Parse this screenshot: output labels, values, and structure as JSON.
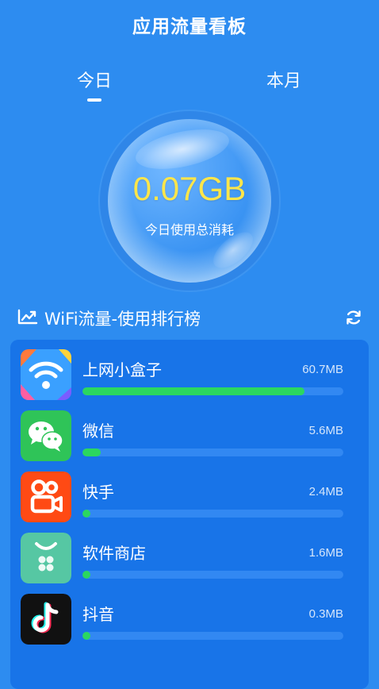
{
  "header": {
    "title": "应用流量看板"
  },
  "tabs": [
    {
      "label": "今日",
      "active": true
    },
    {
      "label": "本月",
      "active": false
    }
  ],
  "summary": {
    "value": "0.07GB",
    "caption": "今日使用总消耗"
  },
  "ranking": {
    "title": "WiFi流量-使用排行榜",
    "icon": "trend-chart-icon",
    "refresh_icon": "refresh-icon"
  },
  "apps": [
    {
      "name": "上网小盒子",
      "usage": "60.7MB",
      "share": 0.85,
      "icon": "wifi-box-app-icon"
    },
    {
      "name": "微信",
      "usage": "5.6MB",
      "share": 0.07,
      "icon": "wechat-app-icon"
    },
    {
      "name": "快手",
      "usage": "2.4MB",
      "share": 0.03,
      "icon": "kuaishou-app-icon"
    },
    {
      "name": "软件商店",
      "usage": "1.6MB",
      "share": 0.02,
      "icon": "app-store-icon"
    },
    {
      "name": "抖音",
      "usage": "0.3MB",
      "share": 0.0,
      "icon": "douyin-app-icon"
    }
  ],
  "colors": {
    "background": "#2d8cf0",
    "card": "#1874e8",
    "progress": "#2bd760",
    "value": "#ffe64a"
  }
}
